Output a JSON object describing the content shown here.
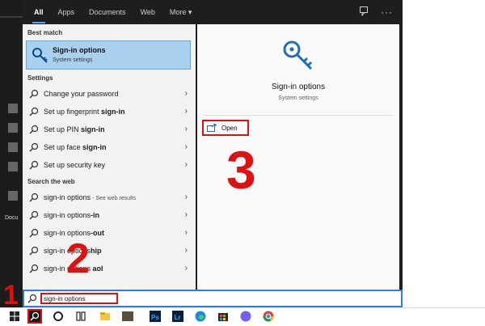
{
  "search_tabs": {
    "items": [
      {
        "label": "All"
      },
      {
        "label": "Apps"
      },
      {
        "label": "Documents"
      },
      {
        "label": "Web"
      },
      {
        "label": "More ▾"
      }
    ]
  },
  "left_panel": {
    "best_match_header": "Best match",
    "best_match": {
      "title": "Sign-in options",
      "subtitle": "System settings"
    },
    "settings_header": "Settings",
    "settings": [
      {
        "pre": "Change your password",
        "bold": "",
        "post": ""
      },
      {
        "pre": "Set up fingerprint ",
        "bold": "sign-in",
        "post": ""
      },
      {
        "pre": "Set up PIN ",
        "bold": "sign-in",
        "post": ""
      },
      {
        "pre": "Set up face ",
        "bold": "sign-in",
        "post": ""
      },
      {
        "pre": "Set up security key",
        "bold": "",
        "post": ""
      }
    ],
    "web_header": "Search the web",
    "web": [
      {
        "pre": "sign-in options",
        "bold": "",
        "hint": " - See web results"
      },
      {
        "pre": "sign-in options",
        "bold": "-in",
        "hint": ""
      },
      {
        "pre": "sign-in options",
        "bold": "-out",
        "hint": ""
      },
      {
        "pre": "sign-in options",
        "bold": "hip",
        "hint": ""
      },
      {
        "pre": "sign-in options ",
        "bold": "aol",
        "hint": ""
      }
    ]
  },
  "preview": {
    "title": "Sign-in options",
    "subtitle": "System settings",
    "open_label": "Open"
  },
  "search": {
    "value": "sign-in options"
  },
  "desktop": {
    "doc_label": "Docu"
  },
  "annotations": {
    "step1": "1",
    "step2": "2",
    "step3": "3"
  },
  "colors": {
    "accent": "#2f7fd8",
    "highlight": "#aad0f0",
    "annotation": "#e01010"
  },
  "icons": {
    "best_match": "key-icon",
    "settings_row": "search-icon",
    "web_row": "search-icon",
    "open": "open-window-icon",
    "taskbar": [
      "windows-start-icon",
      "search-icon",
      "cortana-icon",
      "task-view-icon",
      "file-explorer-icon",
      "photoshop-icon",
      "lightroom-icon",
      "edge-icon",
      "store-icon",
      "viber-icon",
      "chrome-icon"
    ]
  }
}
